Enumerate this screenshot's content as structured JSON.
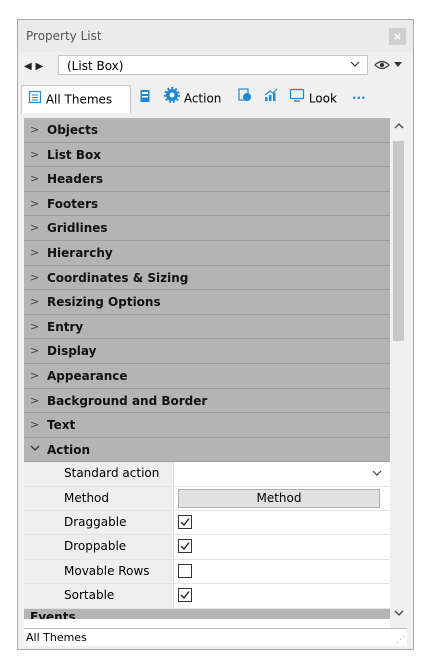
{
  "window": {
    "title": "Property List",
    "close_glyph": "×"
  },
  "selector": {
    "nav_left": "◀",
    "nav_right": "▶",
    "current_object": "(List Box)",
    "eye_glyph": "👁"
  },
  "tabs": [
    {
      "label": "All Themes",
      "icon": "list-icon",
      "active": true
    },
    {
      "label": "",
      "icon": "object-icon"
    },
    {
      "label": "Action",
      "icon": "gear-icon"
    },
    {
      "label": "",
      "icon": "paint-icon"
    },
    {
      "label": "",
      "icon": "chart-icon"
    },
    {
      "label": "Look",
      "icon": "monitor-icon"
    },
    {
      "label": "···",
      "icon": "more-icon"
    }
  ],
  "categories": [
    "Objects",
    "List Box",
    "Headers",
    "Footers",
    "Gridlines",
    "Hierarchy",
    "Coordinates & Sizing",
    "Resizing Options",
    "Entry",
    "Display",
    "Appearance",
    "Background and Border",
    "Text"
  ],
  "expanded_category": "Action",
  "properties": [
    {
      "name": "Standard action",
      "type": "dropdown",
      "value": ""
    },
    {
      "name": "Method",
      "type": "button",
      "value": "Method"
    },
    {
      "name": "Draggable",
      "type": "checkbox",
      "checked": true
    },
    {
      "name": "Droppable",
      "type": "checkbox",
      "checked": true
    },
    {
      "name": "Movable Rows",
      "type": "checkbox",
      "checked": false
    },
    {
      "name": "Sortable",
      "type": "checkbox",
      "checked": true
    }
  ],
  "next_category_partial": "Events",
  "status": {
    "text": "All Themes"
  },
  "colors": {
    "category_bg": "#b4b4b4",
    "accent": "#1e88d3"
  }
}
